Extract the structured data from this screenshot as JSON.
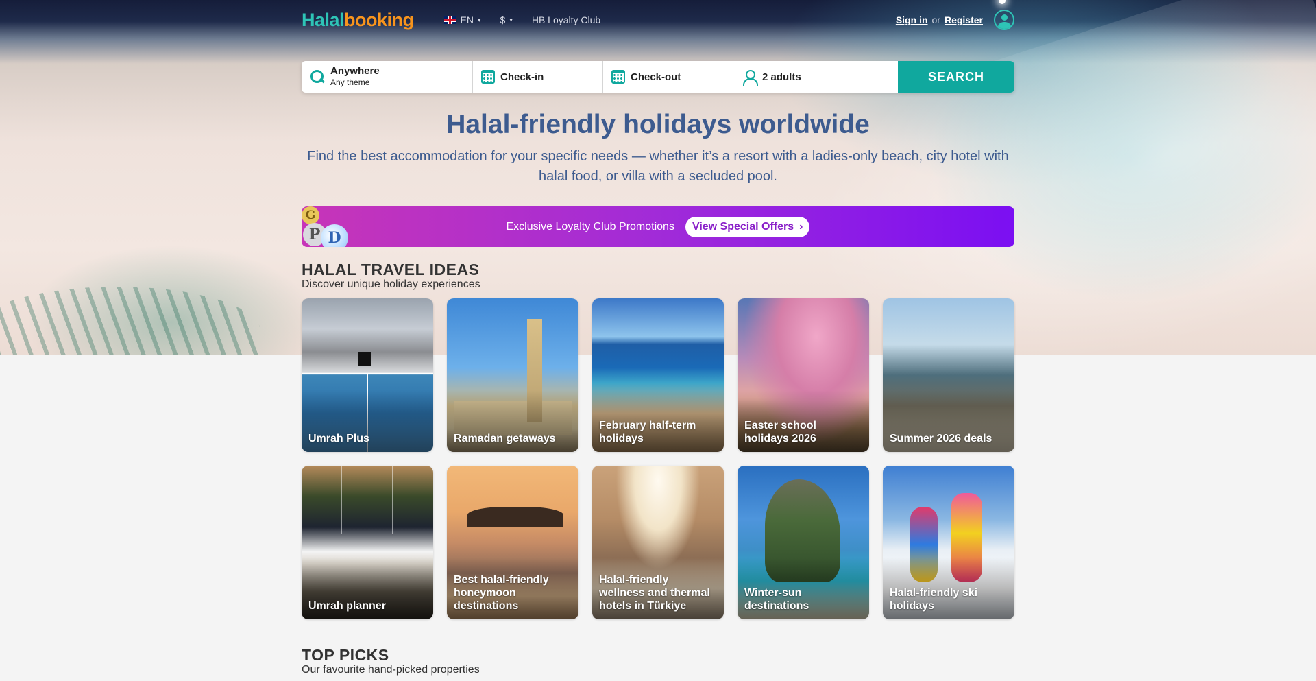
{
  "header": {
    "logo_part1": "Halal",
    "logo_part2": "booking",
    "language": "EN",
    "currency": "$",
    "loyalty_link": "HB Loyalty Club",
    "sign_in": "Sign in",
    "or": "or",
    "register": "Register"
  },
  "search": {
    "destination": "Anywhere",
    "theme": "Any theme",
    "check_in": "Check-in",
    "check_out": "Check-out",
    "guests": "2 adults",
    "button": "SEARCH"
  },
  "hero": {
    "title": "Halal-friendly holidays worldwide",
    "subtitle": "Find the best accommodation for your specific needs — whether it’s a resort with a ladies-only beach, city hotel with halal food, or villa with a secluded pool."
  },
  "promo": {
    "text": "Exclusive Loyalty Club Promotions",
    "button": "View Special Offers",
    "coin_g": "G",
    "coin_p": "P",
    "coin_d": "D"
  },
  "travel_ideas": {
    "title": "HALAL TRAVEL IDEAS",
    "subtitle": "Discover unique holiday experiences",
    "cards": [
      {
        "label": "Umrah Plus"
      },
      {
        "label": "Ramadan getaways"
      },
      {
        "label": "February half-term holidays"
      },
      {
        "label": "Easter school holidays 2026"
      },
      {
        "label": "Summer 2026 deals"
      },
      {
        "label": "Umrah planner"
      },
      {
        "label": "Best halal-friendly honeymoon destinations"
      },
      {
        "label": "Halal-friendly wellness and thermal hotels in Türkiye"
      },
      {
        "label": "Winter-sun destinations"
      },
      {
        "label": "Halal-friendly ski holidays"
      }
    ]
  },
  "top_picks": {
    "title": "TOP PICKS",
    "subtitle": "Our favourite hand-picked properties"
  },
  "colors": {
    "accent": "#10a89e",
    "header_bg": "#151d3a",
    "hero_text": "#3d5b8f",
    "promo_start": "#c735b8",
    "promo_end": "#7b0ff2"
  }
}
